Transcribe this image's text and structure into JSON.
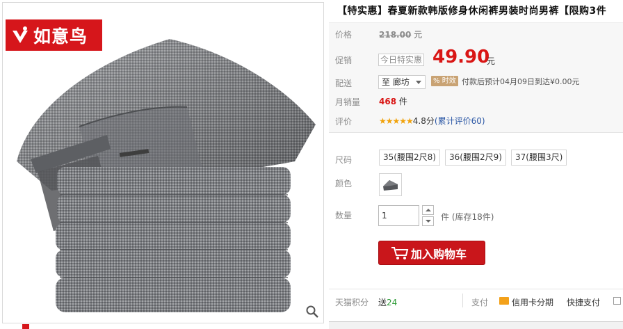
{
  "brand": {
    "name": "如意鸟",
    "color": "#d6161b"
  },
  "product": {
    "title": "【特实惠】春夏新款韩版修身休闲裤男装时尚男裤【限购3件"
  },
  "price": {
    "label": "价格",
    "original": "218.00",
    "unit": "元"
  },
  "promo": {
    "label": "促销",
    "tag": "今日特实惠",
    "price": "49.90",
    "unit": "元",
    "color": "#d91615"
  },
  "shipping": {
    "label": "配送",
    "destination": "至 廊坊",
    "badge": "时效",
    "note": "付款后预计04月09日到达¥0.00元"
  },
  "sales": {
    "label": "月销量",
    "count": "468",
    "unit": "件"
  },
  "rating": {
    "label": "评价",
    "stars": "★★★★★",
    "score": "4.8分",
    "link": "(累计评价60)"
  },
  "sku": {
    "size_label": "尺码",
    "sizes": [
      "35(腰围2尺8)",
      "36(腰围2尺9)",
      "37(腰围3尺)"
    ],
    "color_label": "颜色",
    "qty_label": "数量",
    "qty_value": "1",
    "qty_unit": "件",
    "stock": "(库存18件)"
  },
  "cart_button": {
    "label": "加入购物车"
  },
  "footer": {
    "points_label": "天猫积分",
    "points_prefix": "送",
    "points_value": "24",
    "pay_label": "支付",
    "card_label": "信用卡分期",
    "express_label": "快捷支付"
  },
  "icons": {
    "zoom": "magnifier-icon",
    "cart": "cart-icon",
    "caret": "chevron-down-icon"
  }
}
